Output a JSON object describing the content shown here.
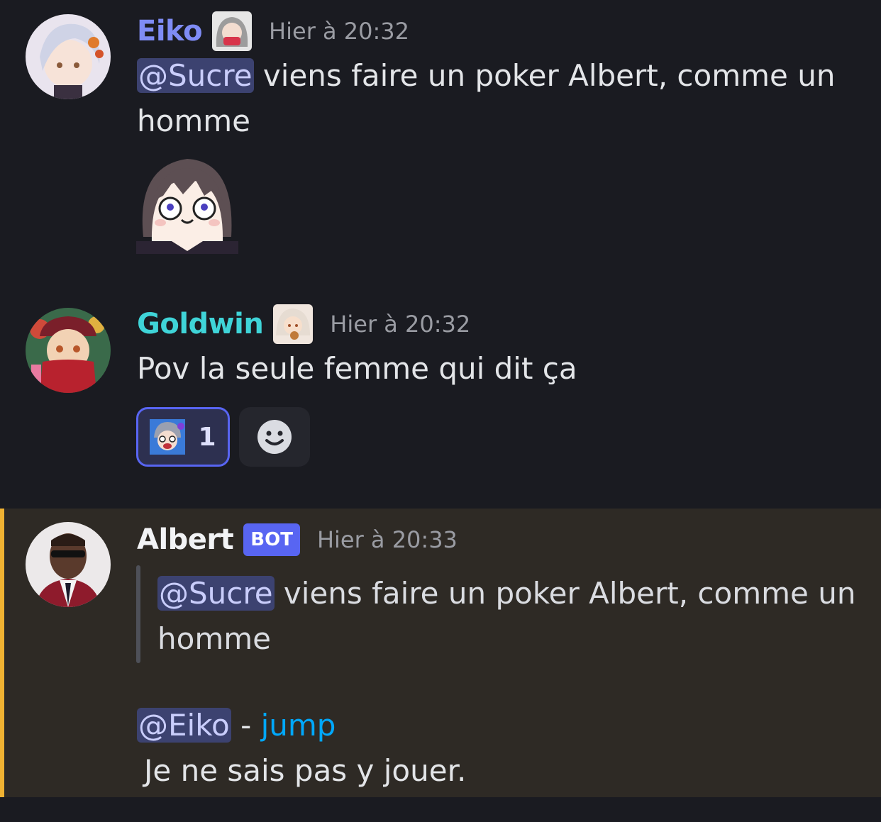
{
  "messages": [
    {
      "author": "Eiko",
      "author_color": "#7f8cf5",
      "timestamp": "Hier à 20:32",
      "mention": "@Sucre",
      "text_line1": " viens faire un poker Albert, comme un",
      "text_line2": "homme",
      "attachment": "sticker-image"
    },
    {
      "author": "Goldwin",
      "author_color": "#3fd4d8",
      "timestamp": "Hier à 20:32",
      "text": "Pov la seule femme qui dit ça",
      "reaction_count": "1",
      "reaction_icon": "emoji-face",
      "add_reaction_icon": "smiley-icon"
    },
    {
      "author": "Albert",
      "author_color": "#f2f3f5",
      "badge": "BOT",
      "timestamp": "Hier à 20:33",
      "quote_mention": "@Sucre",
      "quote_line1": " viens faire un poker Albert, comme un",
      "quote_line2": "homme",
      "reply_mention": "@Eiko",
      "reply_sep": " - ",
      "reply_link": "jump",
      "reply_text": "Je ne sais pas y jouer."
    }
  ],
  "colors": {
    "background": "#1a1b21",
    "highlight": "#2e2a25",
    "highlight_border": "#f0b232",
    "mention_bg": "#3c4270",
    "link": "#00a8fc",
    "bot_badge": "#5865f2"
  }
}
